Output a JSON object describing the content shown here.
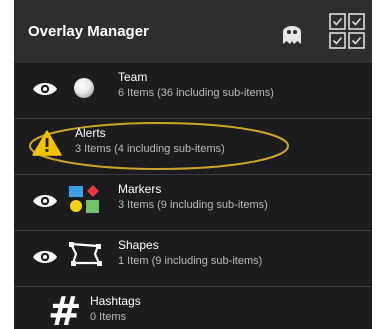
{
  "header": {
    "title": "Overlay Manager"
  },
  "icons": {
    "ghost": "ghost-icon",
    "multiselect": "checklist-grid-icon",
    "search": "search-icon"
  },
  "items": [
    {
      "name": "Team",
      "count": "6 Items (36 including sub-items)",
      "icon": "sphere-icon",
      "visible": true
    },
    {
      "name": "Alerts",
      "count": "3 Items (4 including sub-items)",
      "icon": "warning-icon",
      "visible": false,
      "highlight_color": "#c8a52a"
    },
    {
      "name": "Markers",
      "count": "3 Items (9 including sub-items)",
      "icon": "markers-icon",
      "visible": true
    },
    {
      "name": "Shapes",
      "count": "1 Item (9 including sub-items)",
      "icon": "shapes-icon",
      "visible": true
    },
    {
      "name": "Hashtags",
      "count": "0 Items",
      "icon": "hashtag-icon",
      "visible": false
    }
  ],
  "hashtag_glyph": "#",
  "colors": {
    "background": "#1c1c1e",
    "header": "#2e2e30",
    "warning": "#f2c400",
    "marker_blue": "#3aa0e8",
    "marker_red": "#e23b3b",
    "marker_yellow": "#f2d21b",
    "marker_green": "#6cc36a"
  }
}
